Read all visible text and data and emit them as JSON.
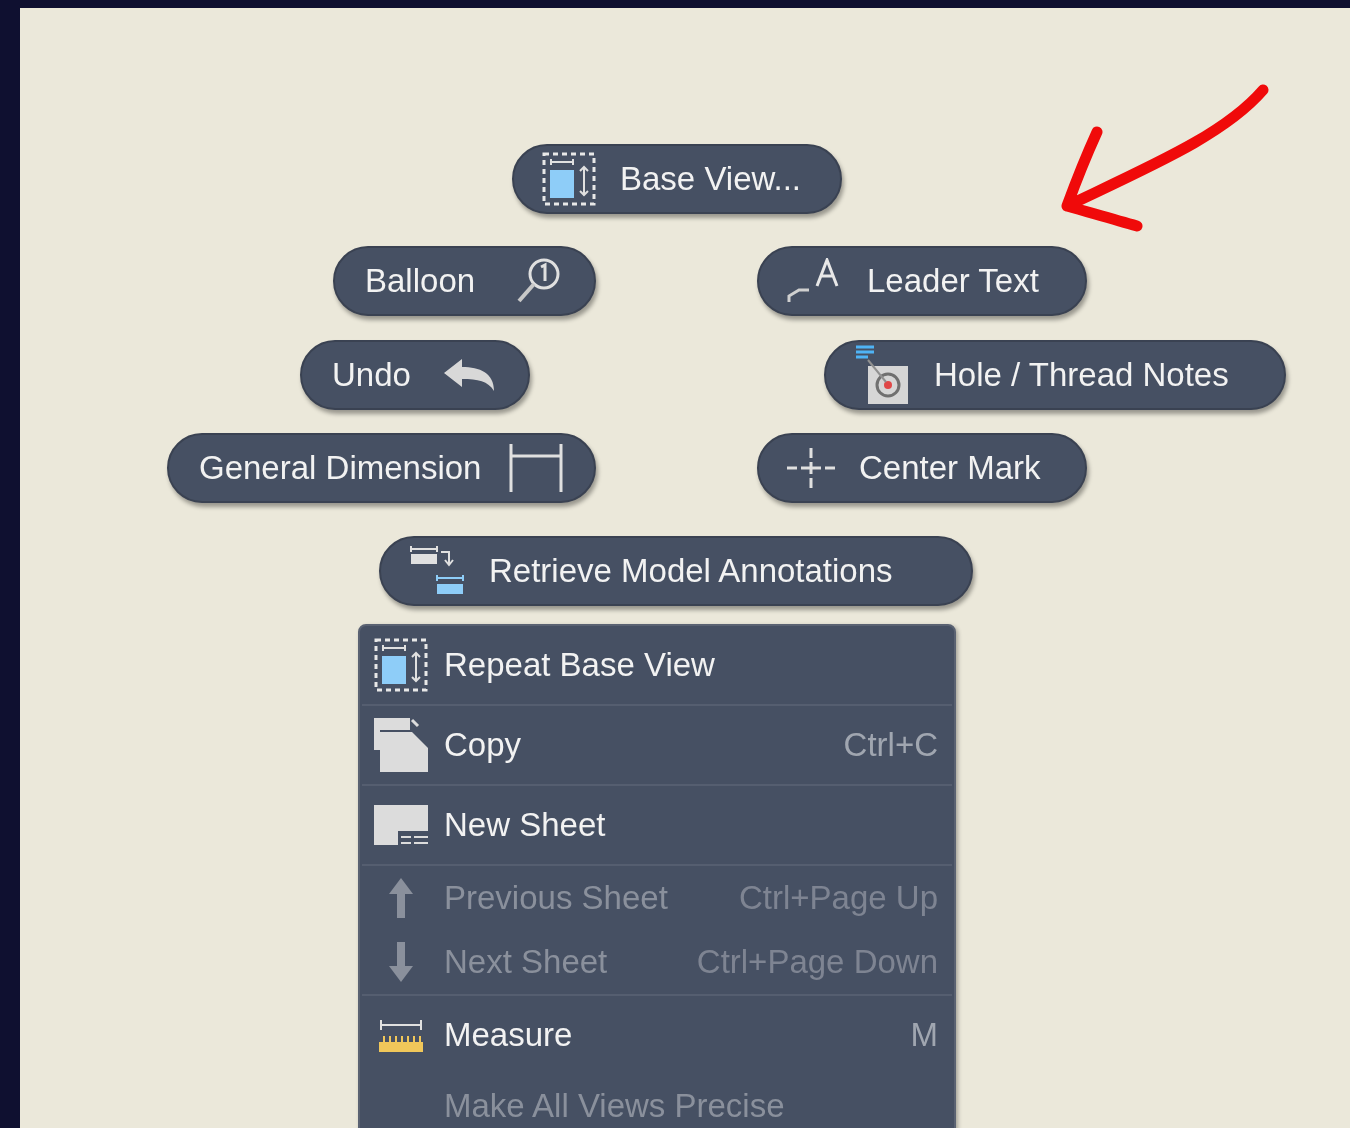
{
  "marking_menu": [
    {
      "label": "Base View...",
      "kind": "base-view"
    },
    {
      "label": "Balloon",
      "kind": "balloon"
    },
    {
      "label": "Leader Text",
      "kind": "leader-text"
    },
    {
      "label": "Undo",
      "kind": "undo"
    },
    {
      "label": "Hole / Thread Notes",
      "kind": "hole-notes"
    },
    {
      "label": "General Dimension",
      "kind": "dimension"
    },
    {
      "label": "Center Mark",
      "kind": "center-mark"
    },
    {
      "label": "Retrieve Model Annotations",
      "kind": "retrieve"
    }
  ],
  "context_menu": {
    "groups": [
      [
        {
          "label": "Repeat Base View",
          "kind": "base-view",
          "disabled": false
        }
      ],
      [
        {
          "label": "Copy",
          "shortcut": "Ctrl+C",
          "kind": "copy",
          "disabled": false
        }
      ],
      [
        {
          "label": "New Sheet",
          "kind": "sheet",
          "disabled": false
        }
      ],
      [
        {
          "label": "Previous Sheet",
          "shortcut": "Ctrl+Page Up",
          "kind": "up",
          "disabled": true
        },
        {
          "label": "Next Sheet",
          "shortcut": "Ctrl+Page Down",
          "kind": "down",
          "disabled": true
        }
      ],
      [
        {
          "label": "Measure",
          "shortcut": "M",
          "kind": "measure",
          "disabled": false
        },
        {
          "label": "Make All Views Precise",
          "kind": "plain",
          "disabled": true
        }
      ]
    ]
  }
}
